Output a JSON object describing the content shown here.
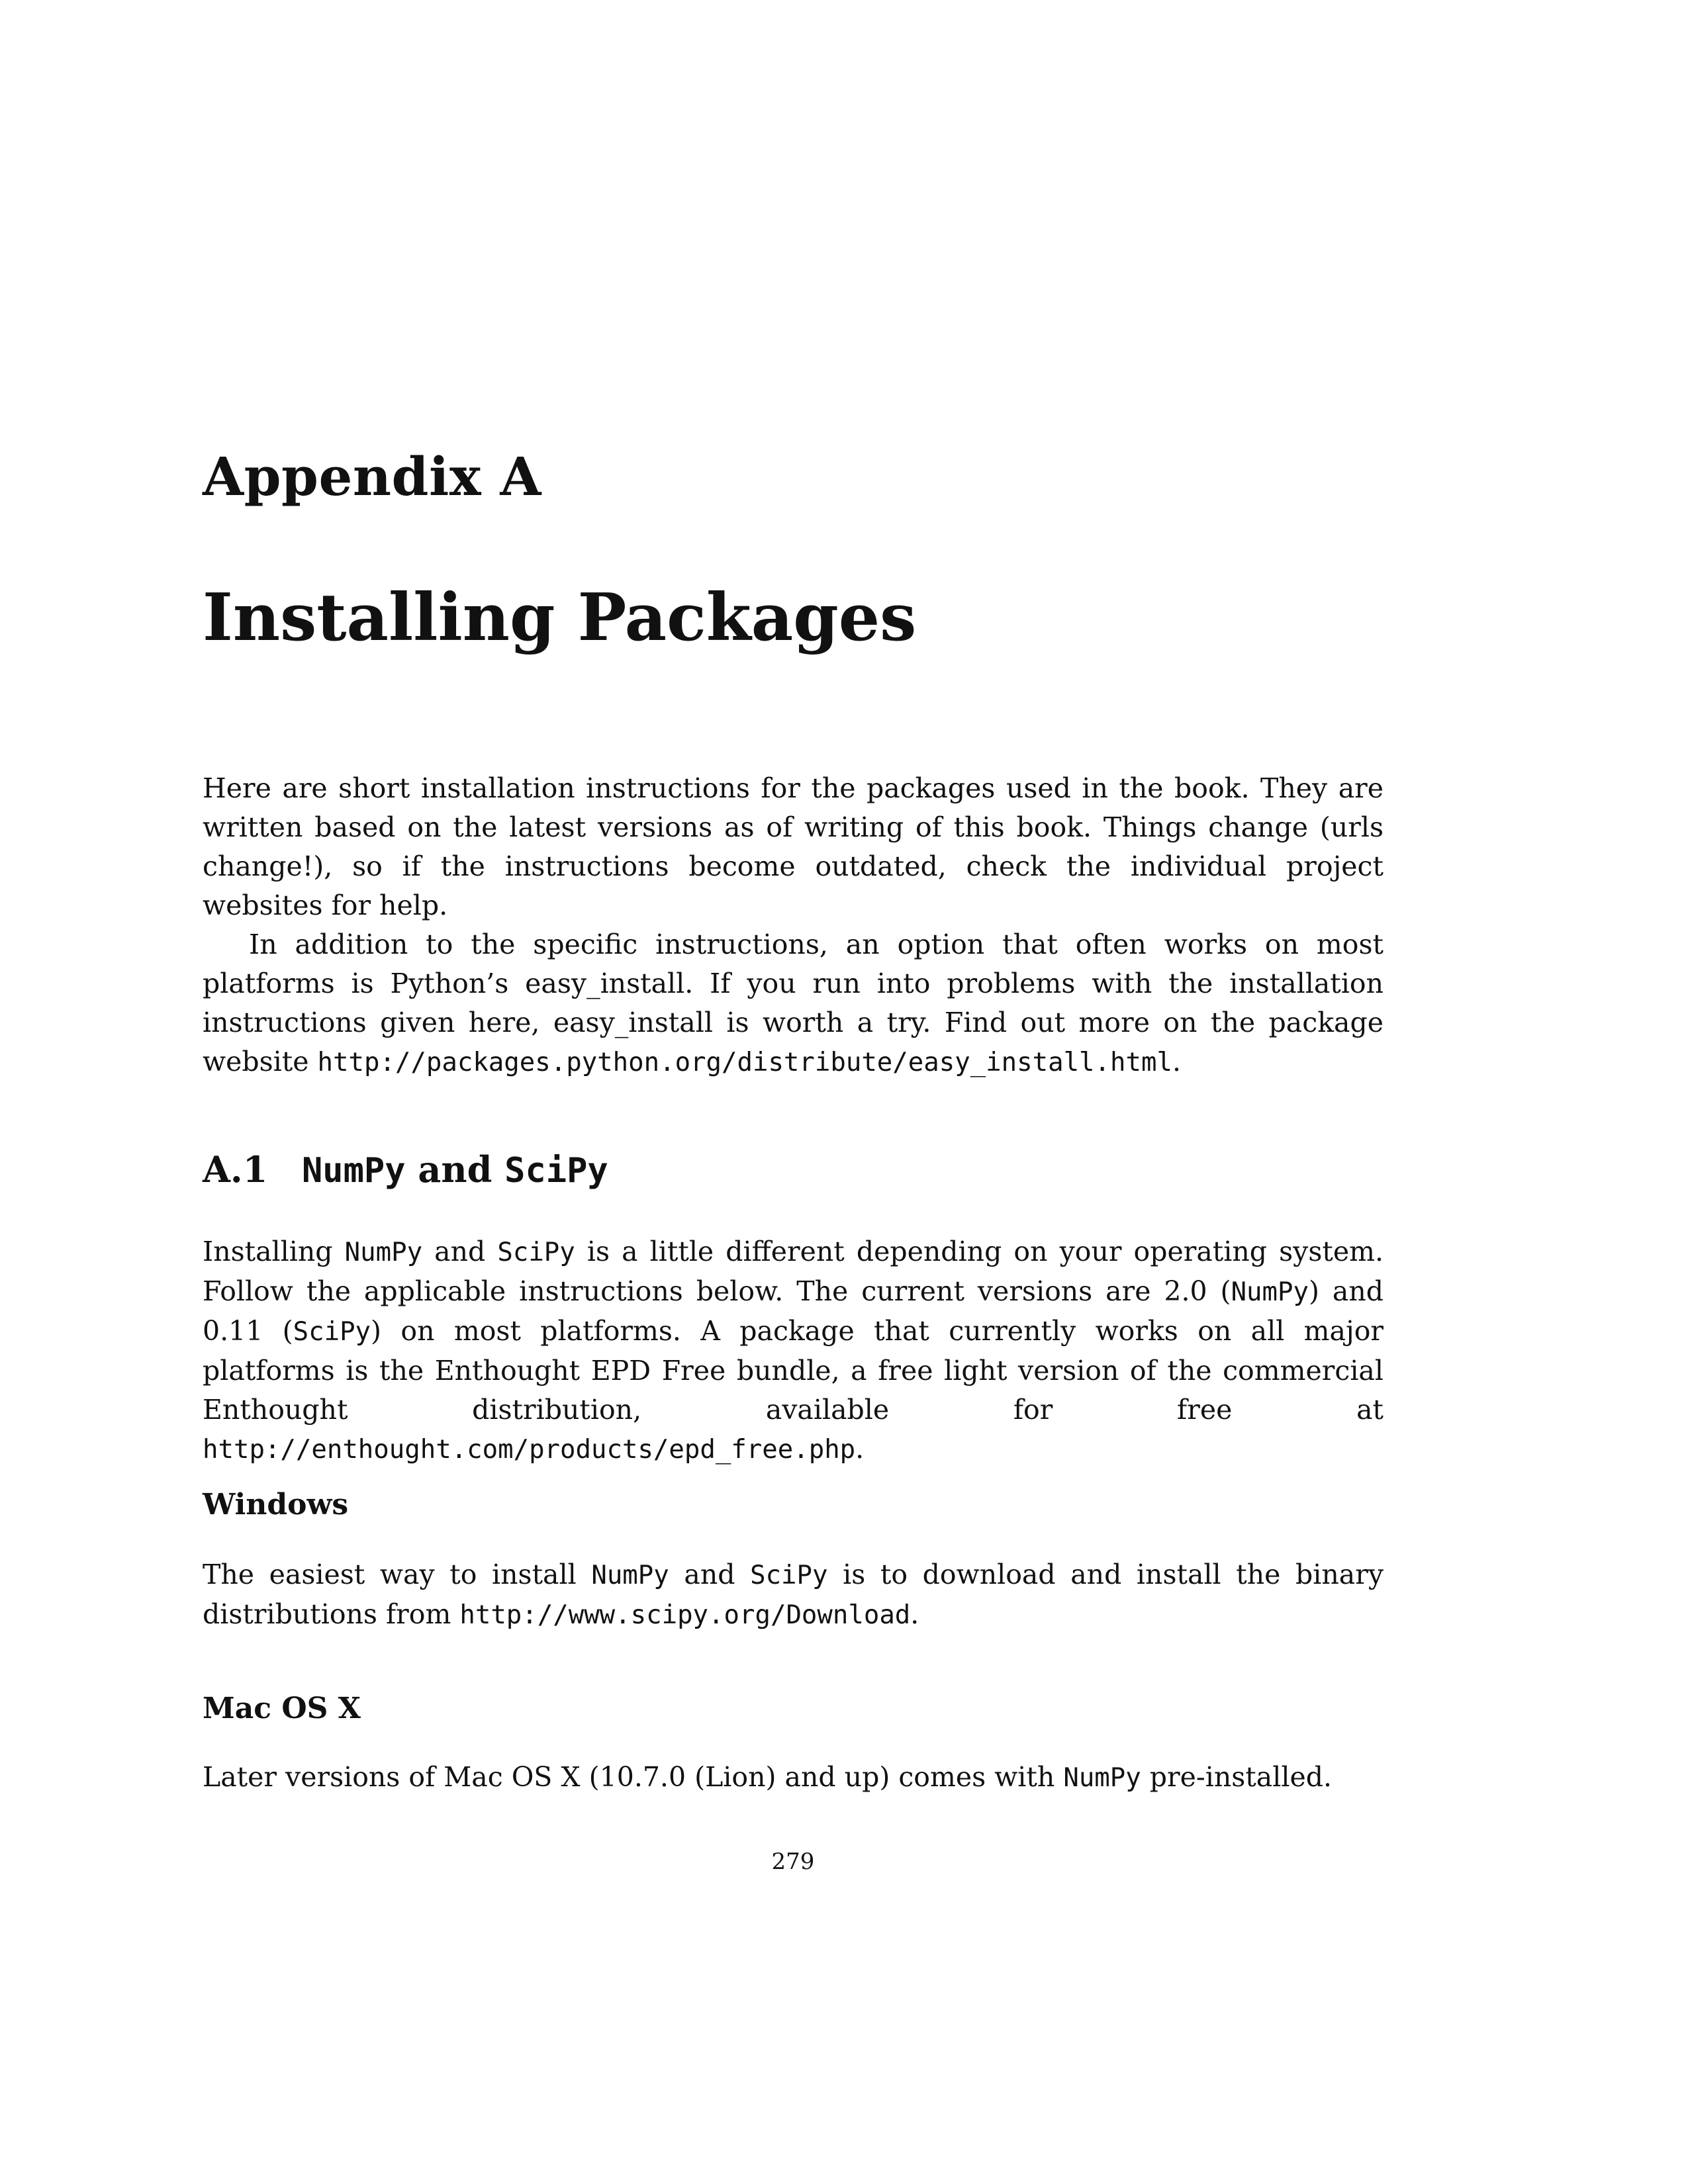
{
  "chapter": {
    "label": "Appendix A",
    "title": "Installing Packages"
  },
  "intro": {
    "p1": "Here are short installation instructions for the packages used in the book. They are written based on the latest versions as of writing of this book. Things change (urls change!), so if the instructions become outdated, check the individual project websites for help.",
    "p2_text": "In addition to the specific instructions, an option that often works on most platforms is Python’s easy_install. If you run into problems with the installation instructions given here, easy_install is worth a try. Find out more on the package website ",
    "p2_url": "http://packages.python.org/distribute/easy_install.html",
    "p2_end": "."
  },
  "section_a1": {
    "number": "A.1",
    "title_numpy": "NumPy",
    "title_and": " and ",
    "title_scipy": "SciPy",
    "p_t1": "Installing ",
    "p_c1": "NumPy",
    "p_t2": " and ",
    "p_c2": "SciPy",
    "p_t3": " is a little different depending on your operating system. Follow the applicable instructions below. The current versions are 2.0 (",
    "p_c3": "NumPy",
    "p_t4": ") and 0.11 (",
    "p_c4": "SciPy",
    "p_t5": ") on most platforms. A package that currently works on all major platforms is the Enthought EPD Free bundle, a free light version of the commercial Enthought distribution, available for free at ",
    "p_url": "http://enthought.com/products/epd_free.php",
    "p_end": "."
  },
  "windows": {
    "heading": "Windows",
    "t1": "The easiest way to install ",
    "c1": "NumPy",
    "t2": " and ",
    "c2": "SciPy",
    "t3": " is to download and install the binary distributions from ",
    "url": "http://www.scipy.org/Download",
    "end": "."
  },
  "mac": {
    "heading": "Mac OS X",
    "t1": "Later versions of Mac OS X (10.7.0 (Lion) and up) comes with ",
    "c1": "NumPy",
    "t2": " pre-installed."
  },
  "page_number": "279"
}
